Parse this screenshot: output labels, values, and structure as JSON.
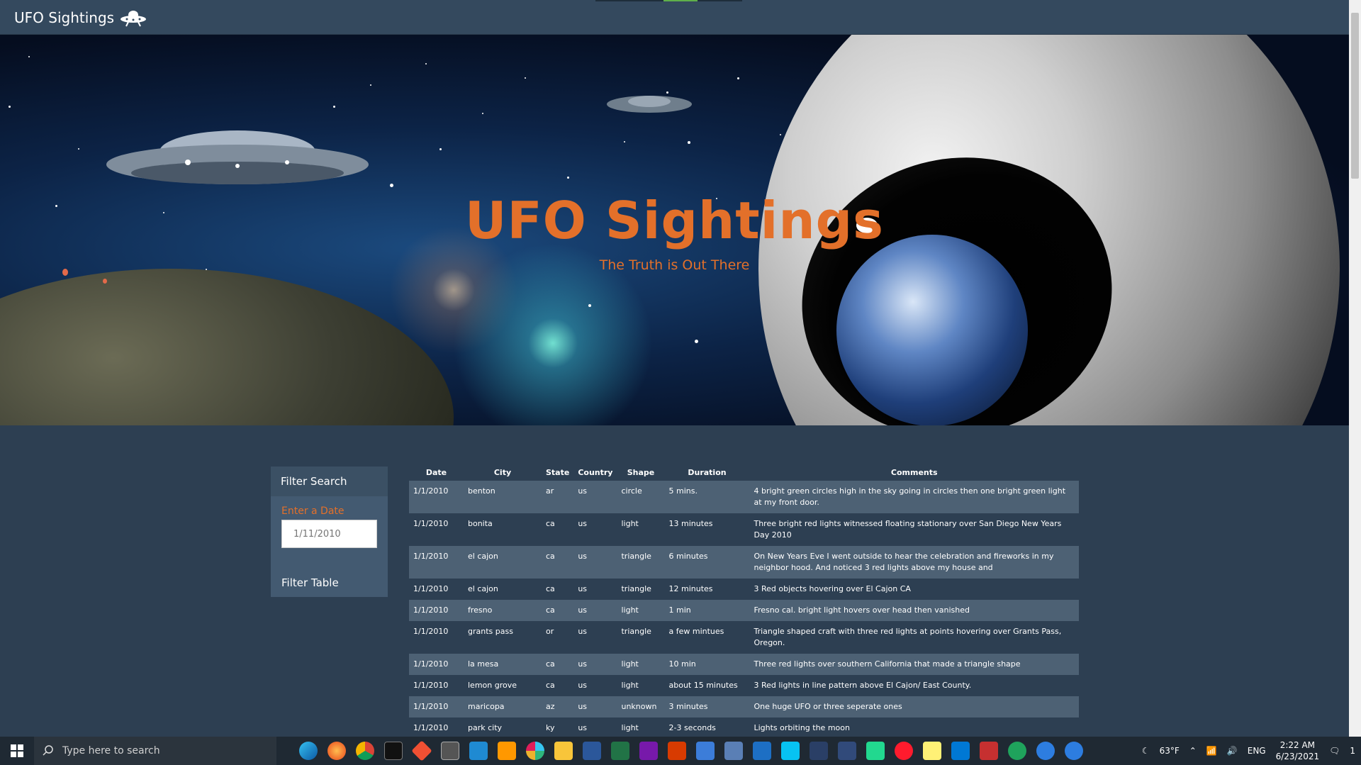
{
  "navbar": {
    "brand": "UFO Sightings",
    "brand_icon": "ufo-icon"
  },
  "hero": {
    "title": "UFO Sightings",
    "subtitle": "The Truth is Out There"
  },
  "filter": {
    "header": "Filter Search",
    "label": "Enter a Date",
    "placeholder": "1/11/2010",
    "button": "Filter Table"
  },
  "table": {
    "headers": [
      "Date",
      "City",
      "State",
      "Country",
      "Shape",
      "Duration",
      "Comments"
    ],
    "rows": [
      [
        "1/1/2010",
        "benton",
        "ar",
        "us",
        "circle",
        "5 mins.",
        "4 bright green circles high in the sky going in circles then one bright green light at my front door."
      ],
      [
        "1/1/2010",
        "bonita",
        "ca",
        "us",
        "light",
        "13 minutes",
        "Three bright red lights witnessed floating stationary over San Diego New Years Day 2010"
      ],
      [
        "1/1/2010",
        "el cajon",
        "ca",
        "us",
        "triangle",
        "6 minutes",
        "On New Years Eve I went outside to hear the celebration and fireworks in my neighbor hood. And noticed 3 red lights above my house and"
      ],
      [
        "1/1/2010",
        "el cajon",
        "ca",
        "us",
        "triangle",
        "12 minutes",
        "3 Red objects hovering over El Cajon CA"
      ],
      [
        "1/1/2010",
        "fresno",
        "ca",
        "us",
        "light",
        "1 min",
        "Fresno cal. bright light hovers over head then vanished"
      ],
      [
        "1/1/2010",
        "grants pass",
        "or",
        "us",
        "triangle",
        "a few mintues",
        "Triangle shaped craft with three red lights at points hovering over Grants Pass, Oregon."
      ],
      [
        "1/1/2010",
        "la mesa",
        "ca",
        "us",
        "light",
        "10 min",
        "Three red lights over southern California that made a triangle shape"
      ],
      [
        "1/1/2010",
        "lemon grove",
        "ca",
        "us",
        "light",
        "about 15 minutes",
        "3 Red lights in line pattern above El Cajon/ East County."
      ],
      [
        "1/1/2010",
        "maricopa",
        "az",
        "us",
        "unknown",
        "3 minutes",
        "One huge UFO or three seperate ones"
      ],
      [
        "1/1/2010",
        "park city",
        "ky",
        "us",
        "light",
        "2-3 seconds",
        "Lights orbiting the moon"
      ]
    ]
  },
  "taskbar": {
    "search_placeholder": "Type here to search",
    "weather": "63°F",
    "language": "ENG",
    "time": "2:22 AM",
    "date": "6/23/2021",
    "notification_count": "1"
  },
  "colors": {
    "accent": "#e3702a",
    "page_bg": "#2d3f52",
    "navbar_bg": "#34495e",
    "row_stripe": "#4d6174"
  }
}
